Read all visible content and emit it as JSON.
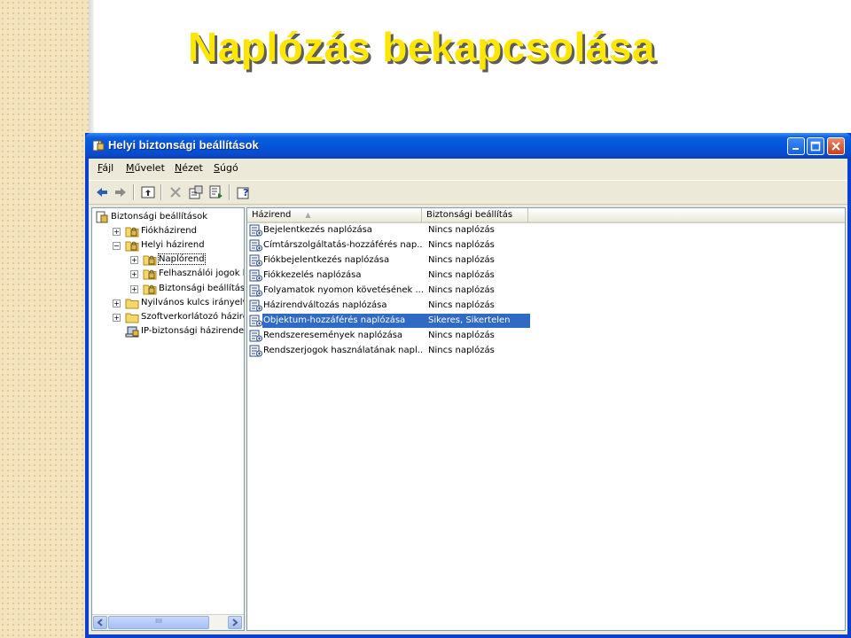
{
  "slide": {
    "title": "Naplózás bekapcsolása"
  },
  "window": {
    "title": "Helyi biztonsági beállítások",
    "title_icon": "security-settings-icon",
    "buttons": [
      "minimize-icon",
      "maximize-icon",
      "close-icon"
    ]
  },
  "menu": {
    "items": [
      {
        "key": "F",
        "rest": "ájl"
      },
      {
        "key": "M",
        "pre": "",
        "rest": "űvelet"
      },
      {
        "key": "N",
        "rest": "ézet"
      },
      {
        "key": "S",
        "rest": "úgó"
      }
    ]
  },
  "toolbar": {
    "icons": [
      "back-icon",
      "forward-icon",
      "up-folder-icon",
      "delete-icon",
      "properties-icon",
      "export-list-icon",
      "help-icon"
    ]
  },
  "tree": {
    "nodes": [
      {
        "label": "Biztonsági beállítások",
        "level": 0,
        "expander": "",
        "icon": "security-root-icon"
      },
      {
        "label": "Fiókházirend",
        "level": 1,
        "expander": "+",
        "icon": "folder-lock-icon"
      },
      {
        "label": "Helyi házirend",
        "level": 1,
        "expander": "−",
        "icon": "folder-lock-icon"
      },
      {
        "label": "Naplórend",
        "level": 2,
        "expander": "+",
        "icon": "folder-lock-icon",
        "selected": true
      },
      {
        "label": "Felhasználói jogok kiosz",
        "level": 2,
        "expander": "+",
        "icon": "folder-lock-icon"
      },
      {
        "label": "Biztonsági beállítások",
        "level": 2,
        "expander": "+",
        "icon": "folder-lock-icon"
      },
      {
        "label": "Nyilvános kulcs irányelvei",
        "level": 1,
        "expander": "+",
        "icon": "folder-icon"
      },
      {
        "label": "Szoftverkorlátozó házirend",
        "level": 1,
        "expander": "+",
        "icon": "folder-icon"
      },
      {
        "label": "IP-biztonsági házirendek - I",
        "level": 1,
        "expander": "",
        "icon": "ip-security-icon"
      }
    ],
    "scrollbar_grip": "IIII"
  },
  "list": {
    "columns": [
      {
        "label": "Házirend",
        "sort": "▲"
      },
      {
        "label": "Biztonsági beállítás"
      },
      {
        "label": ""
      }
    ],
    "rows": [
      {
        "policy": "Bejelentkezés naplózása",
        "setting": "Nincs naplózás"
      },
      {
        "policy": "Címtárszolgáltatás-hozzáférés nap...",
        "setting": "Nincs naplózás"
      },
      {
        "policy": "Fiókbejelentkezés naplózása",
        "setting": "Nincs naplózás"
      },
      {
        "policy": "Fiókkezelés naplózása",
        "setting": "Nincs naplózás"
      },
      {
        "policy": "Folyamatok nyomon követésének ...",
        "setting": "Nincs naplózás"
      },
      {
        "policy": "Házirendváltozás naplózása",
        "setting": "Nincs naplózás"
      },
      {
        "policy": "Objektum-hozzáférés naplózása",
        "setting": "Sikeres, Sikertelen",
        "selected": true
      },
      {
        "policy": "Rendszeresemények naplózása",
        "setting": "Nincs naplózás"
      },
      {
        "policy": "Rendszerjogok használatának napl...",
        "setting": "Nincs naplózás"
      }
    ],
    "row_icon": "audit-policy-icon"
  },
  "colors": {
    "title_yellow": "#ffe600",
    "titlebar_blue": "#0453d8",
    "selection_blue": "#316ac5",
    "window_face": "#ece9d8"
  }
}
